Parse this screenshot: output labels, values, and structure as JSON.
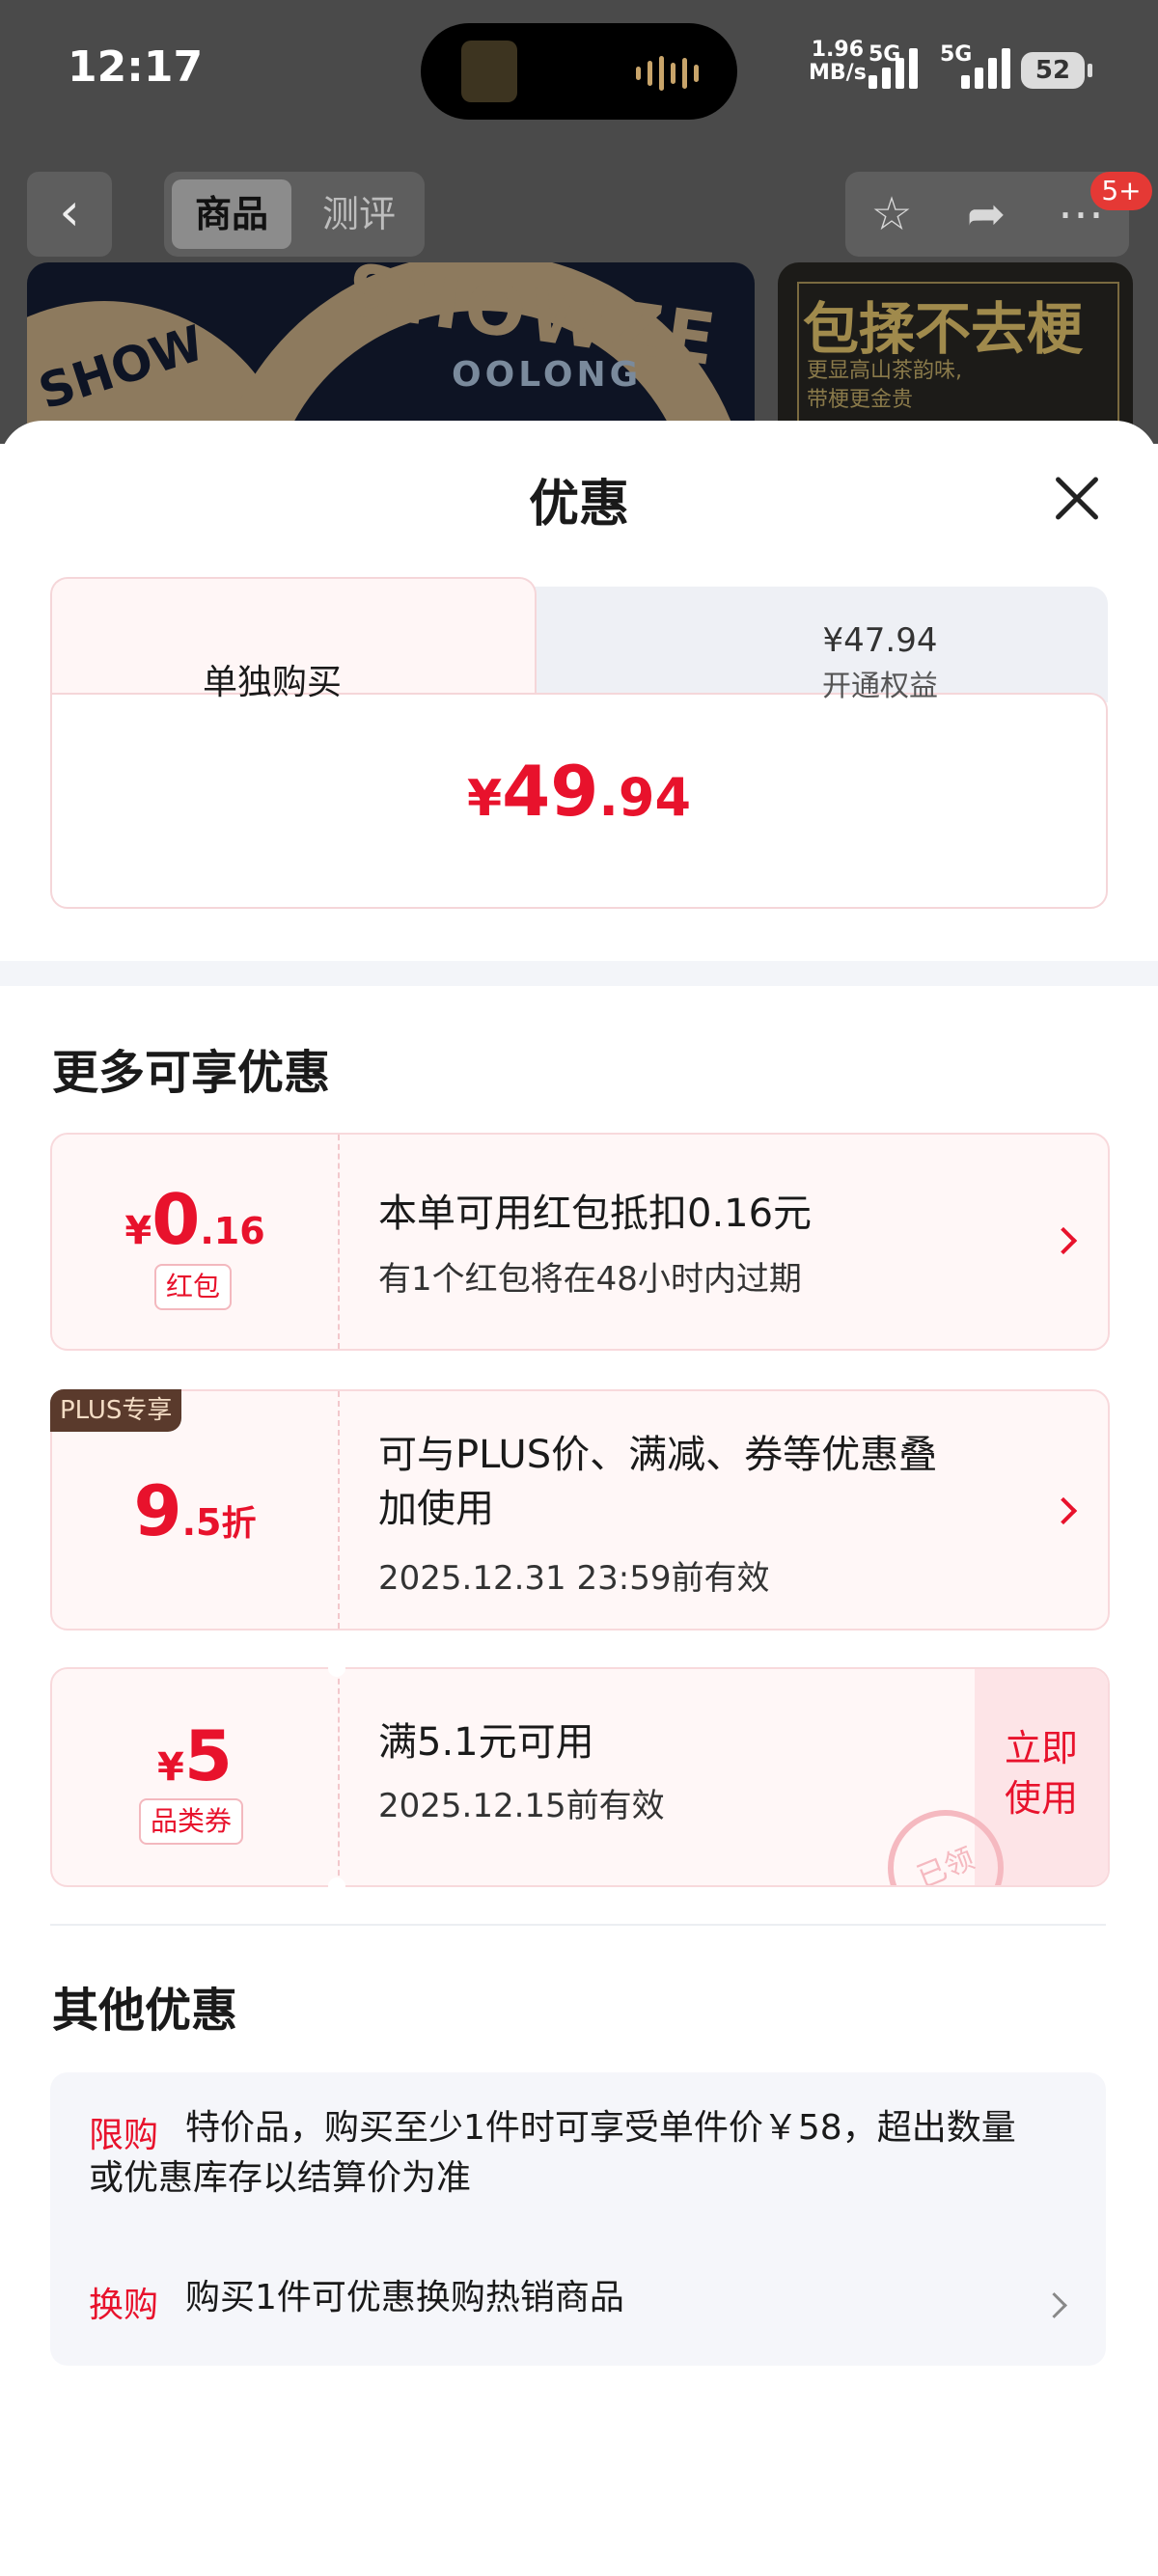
{
  "status_bar": {
    "time": "12:17",
    "net_speed_value": "1.96",
    "net_speed_unit": "MB/s",
    "sim1": "5G",
    "sim2": "5G",
    "battery": "52"
  },
  "nav": {
    "tab_product": "商品",
    "tab_review": "测评",
    "badge": "5+"
  },
  "banner": {
    "brand": "SHOWZE",
    "brand_sub": "OOLONG",
    "brand_small": "SHOW",
    "side_title": "包揉不去梗",
    "side_sub_line1": "更显高山茶韵味,",
    "side_sub_line2": "带梗更金贵"
  },
  "sheet": {
    "title": "优惠",
    "price_tabs": {
      "single_label": "单独购买",
      "member_price": "¥47.94",
      "member_label": "开通权益"
    },
    "main_price": {
      "currency": "¥",
      "integer": "49",
      "decimal": ".94"
    },
    "more_title": "更多可享优惠",
    "promos": [
      {
        "value_currency": "¥",
        "value_int": "0",
        "value_dec": ".16",
        "tag": "红包",
        "text": "本单可用红包抵扣0.16元",
        "sub": "有1个红包将在48小时内过期"
      },
      {
        "badge": "PLUS专享",
        "value_int": "9",
        "value_dec": ".5",
        "value_unit": "折",
        "text_line1": "可与PLUS价、满减、券等优惠叠",
        "text_line2": "加使用",
        "sub": "2025.12.31 23:59前有效"
      },
      {
        "value_currency": "¥",
        "value_int": "5",
        "tag": "品类券",
        "text": "满5.1元可用",
        "sub": "2025.12.15前有效",
        "action_line1": "立即",
        "action_line2": "使用",
        "stamp": "已领"
      }
    ],
    "other_title": "其他优惠",
    "other": [
      {
        "tag": "限购",
        "text": "特价品，购买至少1件时可享受单件价￥58，超出数量或优惠库存以结算价为准"
      },
      {
        "tag": "换购",
        "text": "购买1件可优惠换购热销商品"
      }
    ]
  },
  "colors": {
    "accent_red": "#e8122c",
    "card_bg": "#fff7f7",
    "card_border": "#f8d9dc",
    "plus_badge": "#5a3a2c"
  }
}
